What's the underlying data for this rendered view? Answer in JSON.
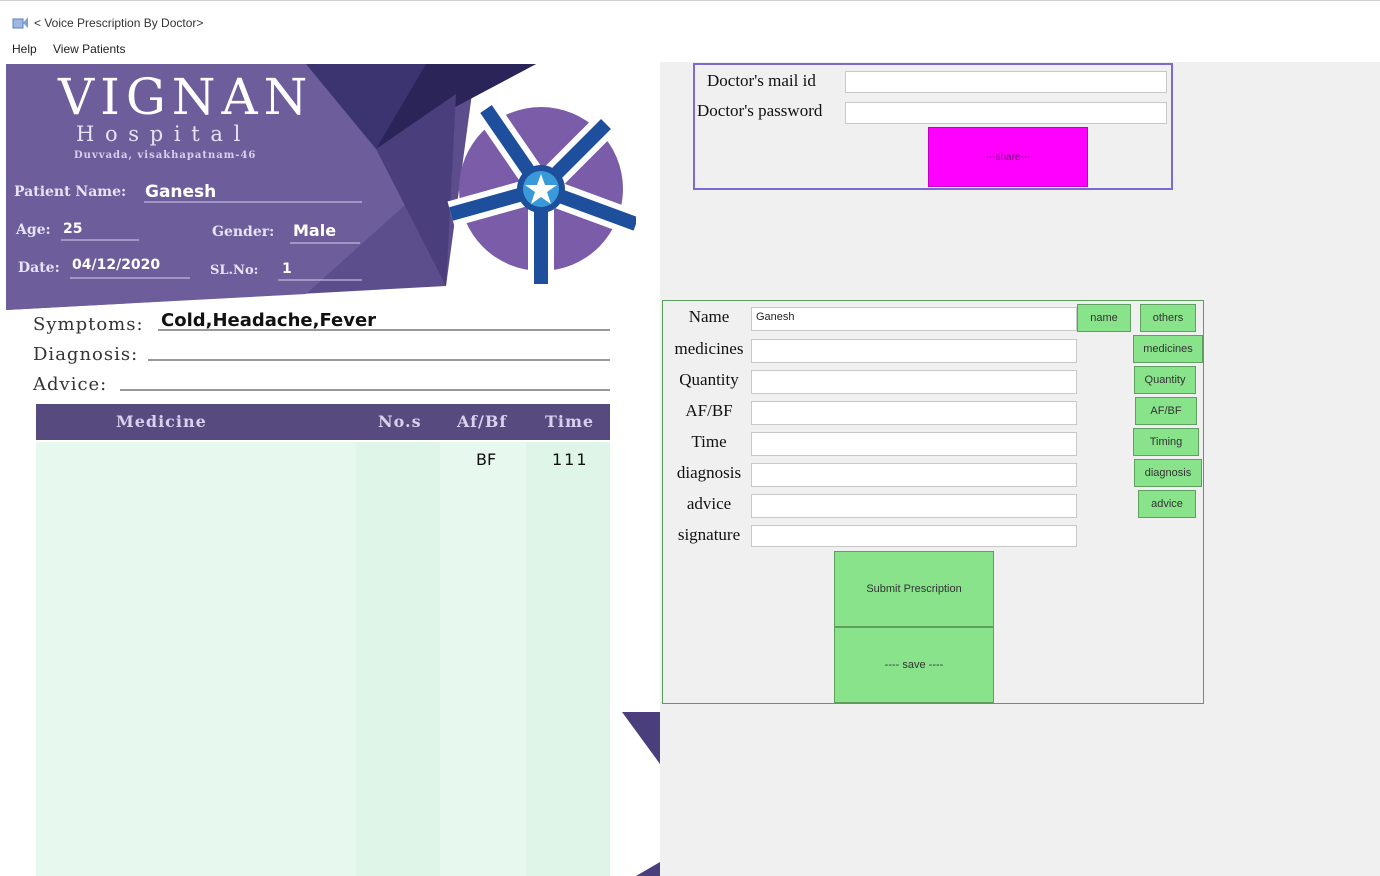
{
  "window": {
    "title": "< Voice Prescription By Doctor>"
  },
  "menu": {
    "items": [
      "Help",
      "View Patients"
    ]
  },
  "prescription": {
    "hospital_name": "VIGNAN",
    "hospital_sub": "H o s p i t a l",
    "address": "Duvvada, visakhapatnam-46",
    "patient_name_label": "Patient Name:",
    "patient_name": "Ganesh",
    "age_label": "Age:",
    "age": "25",
    "gender_label": "Gender:",
    "gender": "Male",
    "date_label": "Date:",
    "date": "04/12/2020",
    "slno_label": "SL.No:",
    "slno": "1",
    "symptoms_label": "Symptoms:",
    "symptoms": "Cold,Headache,Fever",
    "diagnosis_label": "Diagnosis:",
    "diagnosis": "",
    "advice_label": "Advice:",
    "advice": "",
    "table": {
      "headers": [
        "Medicine",
        "No.s",
        "Af/Bf",
        "Time"
      ],
      "rows": [
        [
          "",
          "",
          "BF",
          "111"
        ]
      ]
    }
  },
  "login": {
    "mail_label": "Doctor's mail id",
    "mail_value": "",
    "password_label": "Doctor's password",
    "password_value": "",
    "share_button": "---share---"
  },
  "form": {
    "fields": [
      {
        "label": "Name",
        "value": "Ganesh",
        "button": "name"
      },
      {
        "label": "medicines",
        "value": "",
        "button": "medicines"
      },
      {
        "label": "Quantity",
        "value": "",
        "button": "Quantity"
      },
      {
        "label": "AF/BF",
        "value": "",
        "button": "AF/BF"
      },
      {
        "label": "Time",
        "value": "",
        "button": "Timing"
      },
      {
        "label": "diagnosis",
        "value": "",
        "button": "diagnosis"
      },
      {
        "label": "advice",
        "value": "",
        "button": "advice"
      },
      {
        "label": "signature",
        "value": ""
      }
    ],
    "others_button": "others",
    "submit_button": "Submit Prescription",
    "save_button": "---- save ----"
  },
  "colors": {
    "header_purple": "#5a4b8a",
    "table_header": "#574a7e",
    "table_green": "#e7f8ee",
    "logo_blue": "#1d4f9c",
    "logo_purple": "#7a5ca8",
    "share_magenta": "#ff00ff",
    "button_green": "#88e38a"
  }
}
